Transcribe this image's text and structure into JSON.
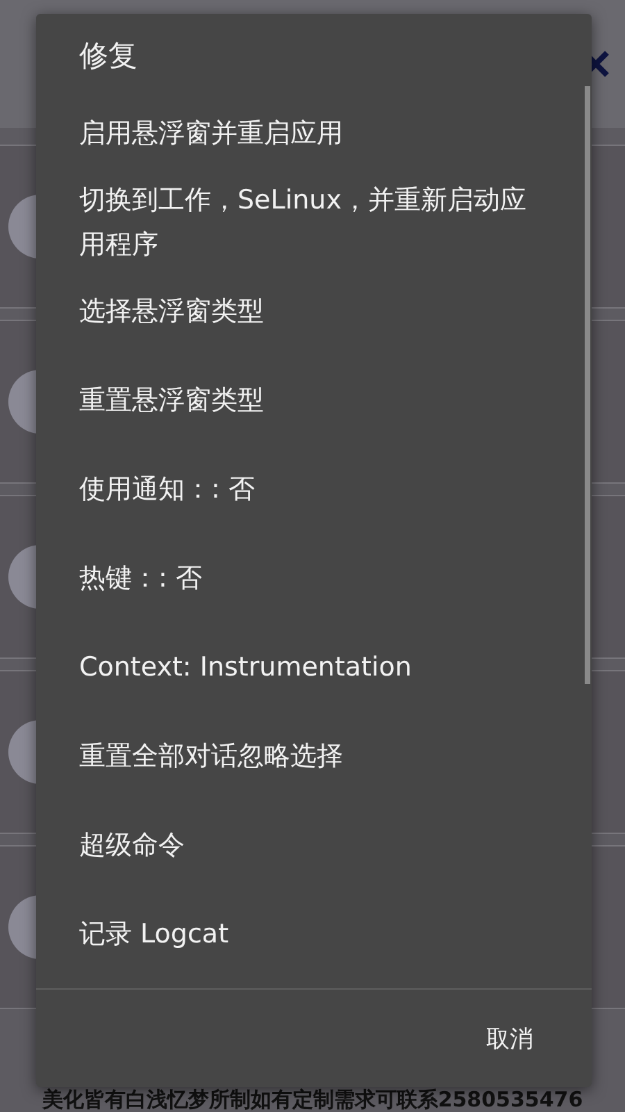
{
  "dialog": {
    "title": "修复",
    "items": [
      {
        "label": "启用悬浮窗并重启应用"
      },
      {
        "label": "切换到工作，SeLinux，并重新启动应用程序"
      },
      {
        "label": "选择悬浮窗类型"
      },
      {
        "label": "重置悬浮窗类型"
      },
      {
        "label": "使用通知：: 否"
      },
      {
        "label": "热键：: 否"
      },
      {
        "label": "Context: Instrumentation"
      },
      {
        "label": "重置全部对话忽略选择"
      },
      {
        "label": "超级命令"
      },
      {
        "label": "记录 Logcat"
      }
    ],
    "cancel": "取消"
  },
  "background": {
    "footer_text": "美化皆有白浅忆梦所制如有定制需求可联系2580535476"
  }
}
